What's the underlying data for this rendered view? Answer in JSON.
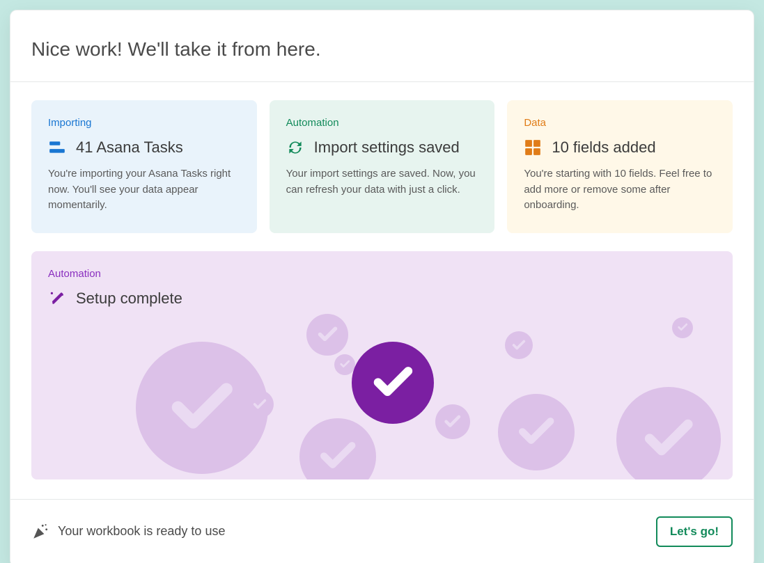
{
  "header": {
    "title": "Nice work! We'll take it from here."
  },
  "cards": {
    "importing": {
      "label": "Importing",
      "title": "41 Asana Tasks",
      "desc": "You're importing your Asana Tasks right now. You'll see your data appear momentarily."
    },
    "automation": {
      "label": "Automation",
      "title": "Import settings saved",
      "desc": "Your import settings are saved. Now, you can refresh your data with just a click."
    },
    "data": {
      "label": "Data",
      "title": "10 fields added",
      "desc": "You're starting with 10 fields. Feel free to add more or remove some after onboarding."
    }
  },
  "big": {
    "label": "Automation",
    "title": "Setup complete"
  },
  "footer": {
    "message": "Your workbook is ready to use",
    "cta": "Let's go!"
  },
  "colors": {
    "purple_main": "#7b1fa2",
    "purple_light": "#dcc1e8"
  }
}
